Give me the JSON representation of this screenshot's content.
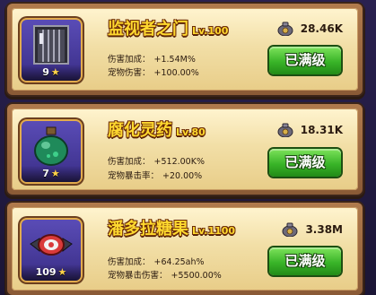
{
  "items": [
    {
      "name": "监视者之门",
      "level": "Lv.100",
      "stars": "9",
      "cost": "28.46K",
      "stats": [
        {
          "label": "伤害加成：",
          "value": "+1.54M%"
        },
        {
          "label": "宠物伤害：",
          "value": "+100.00%"
        }
      ],
      "button": "已满级",
      "icon": "door-icon"
    },
    {
      "name": "腐化灵药",
      "level": "Lv.80",
      "stars": "7",
      "cost": "18.31K",
      "stats": [
        {
          "label": "伤害加成：",
          "value": "+512.00K%"
        },
        {
          "label": "宠物暴击率：",
          "value": "+20.00%"
        }
      ],
      "button": "已满级",
      "icon": "potion-icon"
    },
    {
      "name": "潘多拉糖果",
      "level": "Lv.1100",
      "stars": "109",
      "cost": "3.38M",
      "stats": [
        {
          "label": "伤害加成：",
          "value": "+64.25ah%"
        },
        {
          "label": "宠物暴击伤害：",
          "value": "+5500.00%"
        }
      ],
      "button": "已满级",
      "icon": "candy-icon"
    }
  ],
  "colors": {
    "title": "#ffd92f",
    "button": "#39b428",
    "card": "#f2dfa7"
  },
  "currency_icon": "coin-bag-icon"
}
